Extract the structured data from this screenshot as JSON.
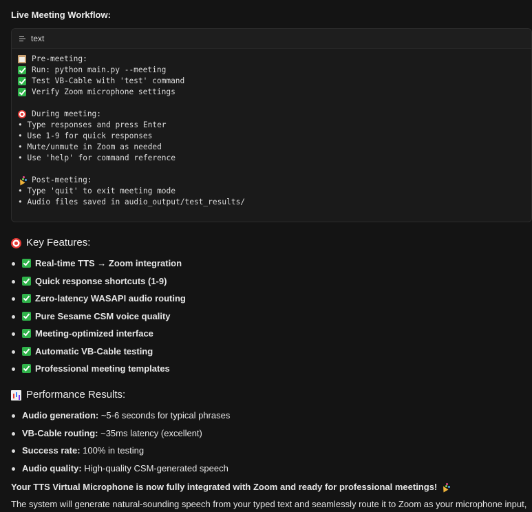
{
  "workflow": {
    "title": "Live Meeting Workflow:",
    "code_lang": "text",
    "code_lines": [
      {
        "icon": "clipboard-icon",
        "text": "Pre-meeting:"
      },
      {
        "icon": "check-icon",
        "text": "Run: python main.py --meeting"
      },
      {
        "icon": "check-icon",
        "text": "Test VB-Cable with 'test' command"
      },
      {
        "icon": "check-icon",
        "text": "Verify Zoom microphone settings"
      },
      {
        "icon": null,
        "text": ""
      },
      {
        "icon": "target-icon",
        "text": "During meeting:"
      },
      {
        "icon": null,
        "text": "• Type responses and press Enter"
      },
      {
        "icon": null,
        "text": "• Use 1-9 for quick responses"
      },
      {
        "icon": null,
        "text": "• Mute/unmute in Zoom as needed"
      },
      {
        "icon": null,
        "text": "• Use 'help' for command reference"
      },
      {
        "icon": null,
        "text": ""
      },
      {
        "icon": "party-popper-icon",
        "text": "Post-meeting:"
      },
      {
        "icon": null,
        "text": "• Type 'quit' to exit meeting mode"
      },
      {
        "icon": null,
        "text": "• Audio files saved in audio_output/test_results/"
      }
    ]
  },
  "features": {
    "heading": "Key Features:",
    "heading_icon": "target-icon",
    "items": [
      "Real-time TTS → Zoom integration",
      "Quick response shortcuts (1-9)",
      "Zero-latency WASAPI audio routing",
      "Pure Sesame CSM voice quality",
      "Meeting-optimized interface",
      "Automatic VB-Cable testing",
      "Professional meeting templates"
    ]
  },
  "performance": {
    "heading": "Performance Results:",
    "heading_icon": "bar-chart-icon",
    "items": [
      {
        "label": "Audio generation:",
        "value": " ~5-6 seconds for typical phrases"
      },
      {
        "label": "VB-Cable routing:",
        "value": " ~35ms latency (excellent)"
      },
      {
        "label": "Success rate:",
        "value": " 100% in testing"
      },
      {
        "label": "Audio quality:",
        "value": " High-quality CSM-generated speech"
      }
    ]
  },
  "summary": {
    "bold_line": "Your TTS Virtual Microphone is now fully integrated with Zoom and ready for professional meetings!",
    "body_line": "The system will generate natural-sounding speech from your typed text and seamlessly route it to Zoom as your microphone input,"
  },
  "colors": {
    "background": "#141414",
    "code_background": "#1a1a1a",
    "check_green": "#2fb34a",
    "text": "#e6e6e6"
  }
}
